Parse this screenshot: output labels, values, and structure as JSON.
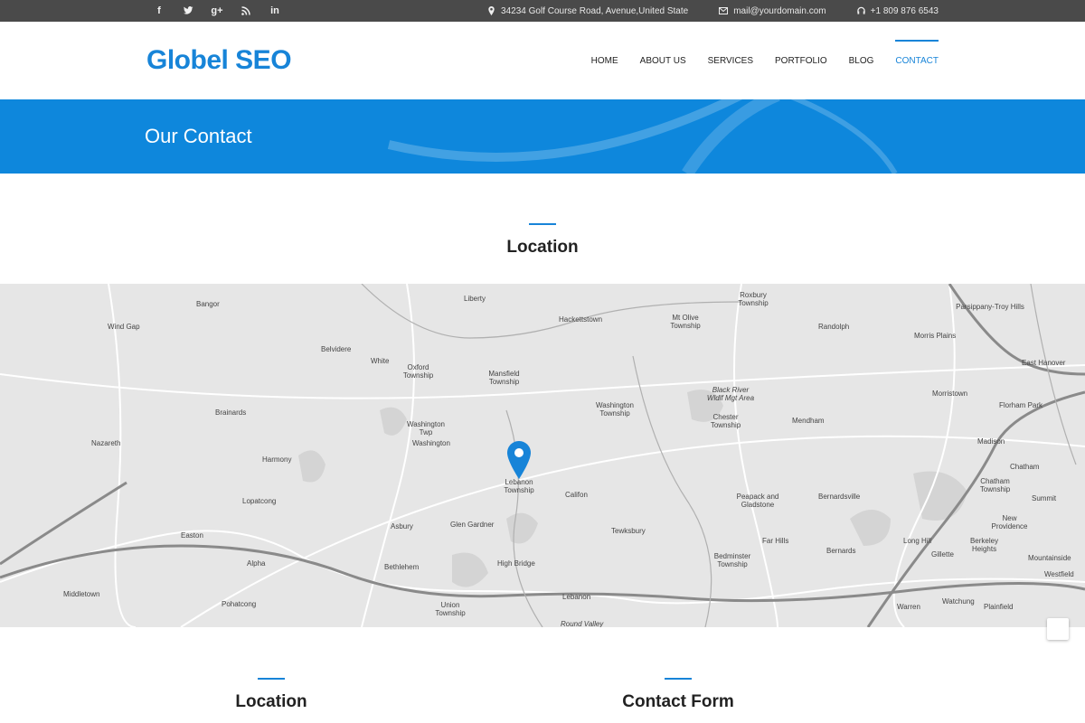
{
  "topbar": {
    "social": [
      "f",
      "t",
      "g+",
      "rss",
      "in"
    ],
    "address": "34234 Golf Course Road, Avenue,United State",
    "email": "mail@yourdomain.com",
    "phone": "+1 809 876 6543"
  },
  "header": {
    "logo": "Globel SEO",
    "nav": [
      "HOME",
      "ABOUT US",
      "SERVICES",
      "PORTFOLIO",
      "BLOG",
      "CONTACT"
    ],
    "active_nav": "CONTACT"
  },
  "banner": {
    "title": "Our Contact"
  },
  "location_section": {
    "title": "Location"
  },
  "map": {
    "places": [
      "Bangor",
      "Liberty",
      "Hackettstown",
      "Mt Olive Township",
      "Roxbury Township",
      "Randolph",
      "Parsippany-Troy Hills",
      "Morris Plains",
      "East Hanover",
      "Wind Gap",
      "Belvidere",
      "White",
      "Oxford Township",
      "Mansfield Township",
      "Washington Township",
      "Black River Wldlf Mgt Area",
      "Chester Township",
      "Mendham",
      "Morristown",
      "Florham Park",
      "Brainards",
      "Washington Twp",
      "Washington",
      "Madison",
      "Chatham",
      "Harmony",
      "Lebanon Township",
      "Califon",
      "Nazareth",
      "Lopatcong",
      "Peapack and Gladstone",
      "Bernardsville",
      "Chatham Township",
      "Summit",
      "Easton",
      "Asbury",
      "Glen Gardner",
      "Tewksbury",
      "Far Hills",
      "Long Hill",
      "New Providence",
      "Berkeley Heights",
      "Alpha",
      "Bethlehem",
      "High Bridge",
      "Bedminster Township",
      "Bernards",
      "Gillette",
      "Mountainside",
      "Westfield",
      "Middletown",
      "Pohatcong",
      "Lebanon",
      "Union Township",
      "Warren",
      "Watchung",
      "Plainfield",
      "Round Valley"
    ],
    "accent_color": "#1784d8"
  },
  "bottom": {
    "location_title": "Location",
    "form_title": "Contact Form"
  }
}
